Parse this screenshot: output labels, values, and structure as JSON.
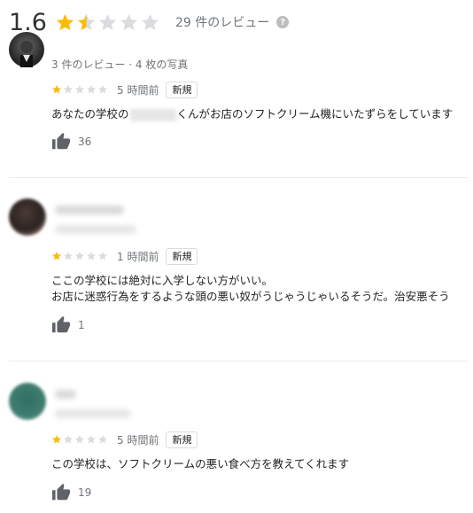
{
  "summary": {
    "rating": "1.6",
    "stars_value": 1.6,
    "review_count": "29 件のレビュー",
    "help_glyph": "?"
  },
  "colors": {
    "star_filled": "#fbbc04",
    "star_empty": "#dadce0",
    "meta_text": "#70757a"
  },
  "reviews": [
    {
      "stars": 1,
      "meta": "3 件のレビュー · 4 枚の写真",
      "time": "5 時間前",
      "badge": "新規",
      "text_before": "あなたの学校の",
      "text_after": "くんがお店のソフトクリーム機にいたずらをしています",
      "likes": "36"
    },
    {
      "stars": 1,
      "time": "1 時間前",
      "badge": "新規",
      "text_line1": "ここの学校には絶対に入学しない方がいい。",
      "text_line2": "お店に迷惑行為をするような頭の悪い奴がうじゃうじゃいるそうだ。治安悪そう",
      "likes": "1"
    },
    {
      "stars": 1,
      "time": "5 時間前",
      "badge": "新規",
      "text": "この学校は、ソフトクリームの悪い食べ方を教えてくれます",
      "likes": "19"
    }
  ]
}
